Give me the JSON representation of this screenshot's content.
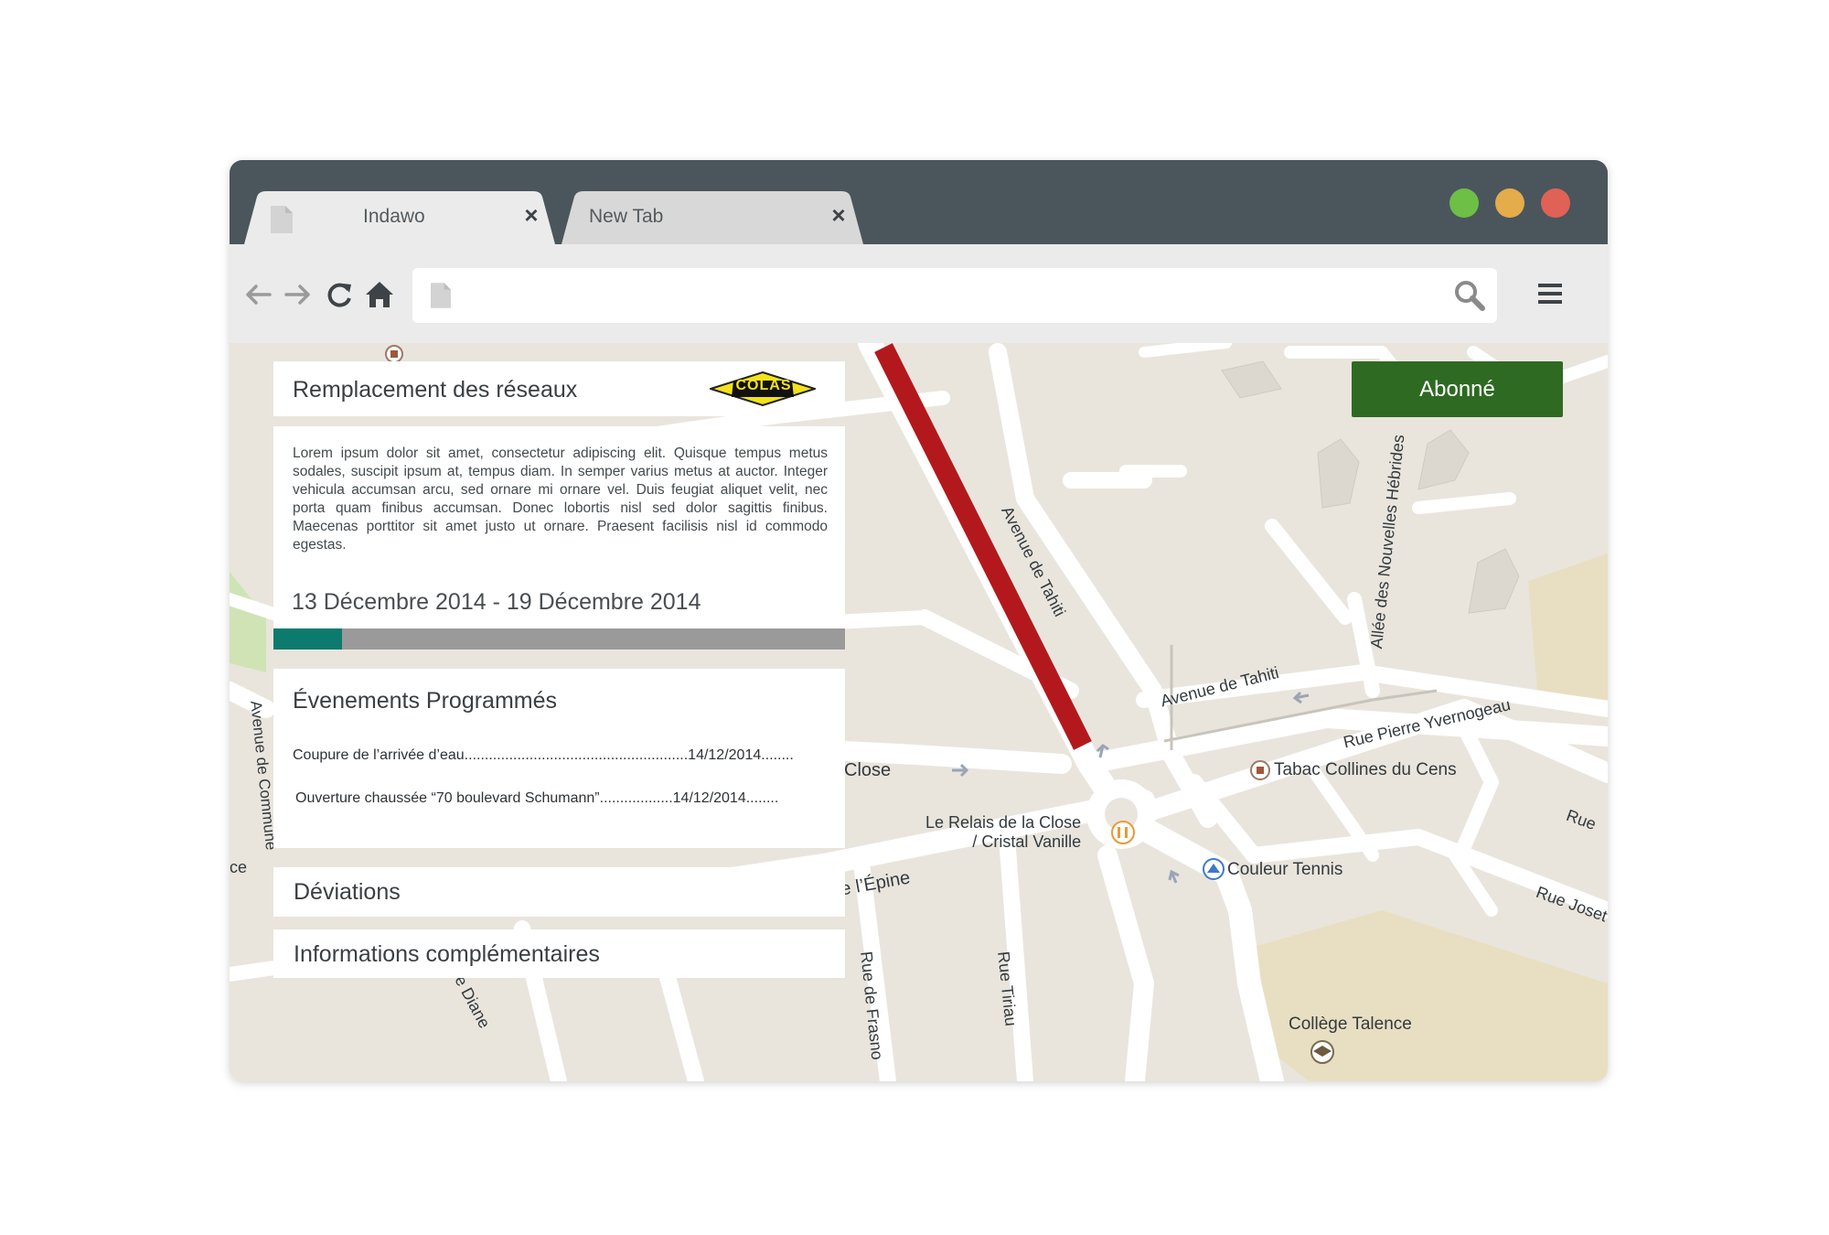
{
  "browser": {
    "tabs": [
      {
        "label": "Indawo",
        "active": true
      },
      {
        "label": "New Tab",
        "active": false
      }
    ],
    "window_controls": {
      "green": "#6ebf45",
      "yellow": "#e4ac4a",
      "red": "#e06155"
    },
    "address_bar": {
      "value": ""
    }
  },
  "panel": {
    "title": "Remplacement des réseaux",
    "logo_text": "COLAS",
    "description": "Lorem ipsum dolor sit amet, consectetur adipiscing elit. Quisque tempus metus sodales, suscipit ipsum at, tempus diam. In semper varius metus at auctor. Integer vehicula accumsan arcu, sed ornare mi ornare vel. Duis feugiat aliquet velit, nec porta quam finibus accumsan. Donec lobortis nisl sed dolor sagittis finibus. Maecenas porttitor sit amet justo ut ornare. Praesent facilisis nisl id commodo egestas.",
    "dates": "13 Décembre 2014 - 19 Décembre 2014",
    "progress_fraction": 0.12,
    "colors": {
      "progress": "#0d7a6e",
      "track": "#9a9a9a"
    }
  },
  "events": {
    "heading": "Évenements Programmés",
    "items": [
      {
        "text": "Coupure de l’arrivée d’eau.......................................................14/12/2014........"
      },
      {
        "text": "Ouverture chaussée “70 boulevard Schumann”..................14/12/2014........"
      }
    ]
  },
  "sections": {
    "deviations": "Déviations",
    "infos": "Informations complémentaires"
  },
  "subscribe": {
    "label": "Abonné",
    "color": "#2e6a22"
  },
  "map": {
    "streets": {
      "avenue_tahiti_1": "Avenue de Tahiti",
      "avenue_tahiti_2": "Avenue de Tahiti",
      "rue_pierre": "Rue Pierre Yvernogeau",
      "allee": "Allée des Nouvelles Hébrides",
      "close": "Close",
      "rue_epine": "Rue de l’Épine",
      "rue_frasno": "Rue de Frasno",
      "rue_tiriau": "Rue Tiriau",
      "rue_diane": "e Diane",
      "avenue_commune": "Avenue de Commune",
      "rue_right": "Rue",
      "rue_joset": "Rue Joset",
      "ce": "ce"
    },
    "places": {
      "relais": "Le Relais de la Close\n/ Cristal Vanille",
      "tabac": "Tabac Collines du Cens",
      "tennis": "Couleur Tennis",
      "college": "Collège Talence"
    },
    "closed_road_color": "#b3191c"
  }
}
